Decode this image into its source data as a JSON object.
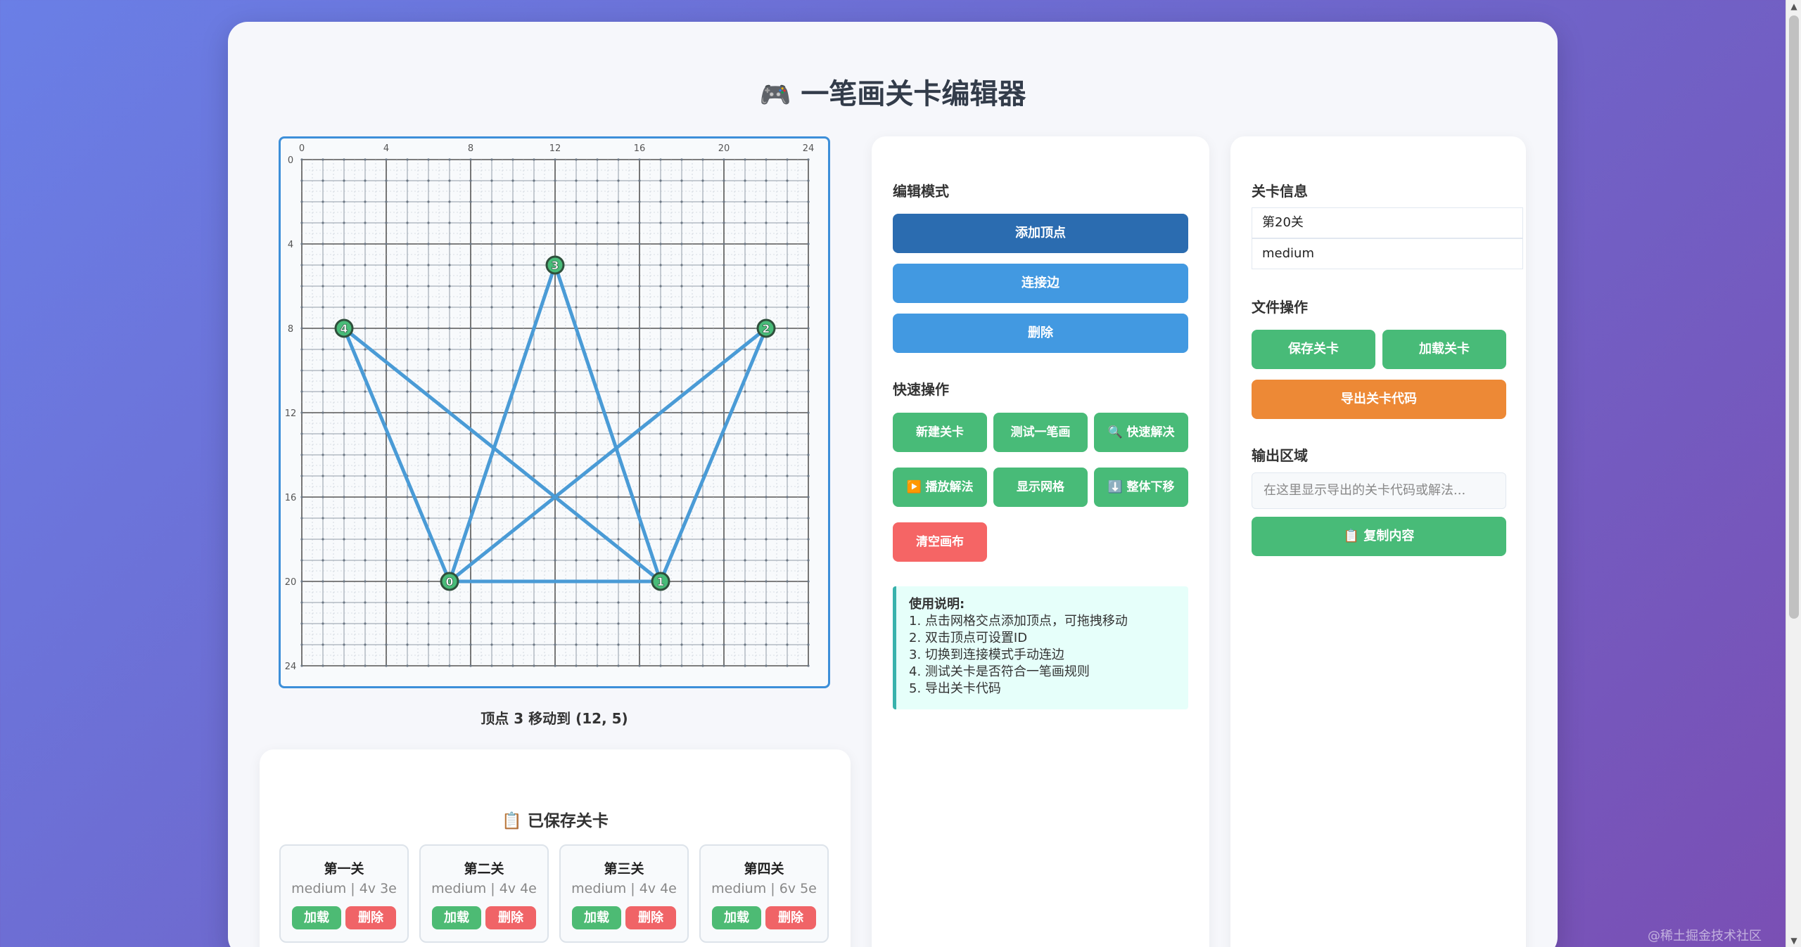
{
  "page": {
    "title_icon": "🎮",
    "title": "一笔画关卡编辑器",
    "status": "顶点 3 移动到 (12, 5)",
    "watermark": "@稀土掘金技术社区"
  },
  "canvas": {
    "grid_size": 24,
    "axis_ticks": [
      0,
      4,
      8,
      12,
      16,
      20,
      24
    ],
    "vertices": [
      {
        "id": "0",
        "x": 7,
        "y": 20
      },
      {
        "id": "1",
        "x": 17,
        "y": 20
      },
      {
        "id": "2",
        "x": 22,
        "y": 8
      },
      {
        "id": "3",
        "x": 12,
        "y": 5
      },
      {
        "id": "4",
        "x": 2,
        "y": 8
      }
    ],
    "edges": [
      [
        "0",
        "1"
      ],
      [
        "0",
        "3"
      ],
      [
        "3",
        "1"
      ],
      [
        "1",
        "4"
      ],
      [
        "4",
        "0"
      ],
      [
        "0",
        "2"
      ],
      [
        "2",
        "1"
      ]
    ],
    "colors": {
      "edge": "#4a9bd6",
      "vertex_fill": "#48bb78",
      "vertex_stroke": "#2f4f3c",
      "grid_major": "#555555",
      "grid_minor": "#b9c2cc"
    }
  },
  "saved": {
    "icon": "📋",
    "title": "已保存关卡",
    "levels": [
      {
        "name": "第一关",
        "meta": "medium | 4v 3e",
        "load": "加载",
        "delete": "删除"
      },
      {
        "name": "第二关",
        "meta": "medium | 4v 4e",
        "load": "加载",
        "delete": "删除"
      },
      {
        "name": "第三关",
        "meta": "medium | 4v 4e",
        "load": "加载",
        "delete": "删除"
      },
      {
        "name": "第四关",
        "meta": "medium | 6v 5e",
        "load": "加载",
        "delete": "删除"
      }
    ]
  },
  "edit": {
    "mode_heading": "编辑模式",
    "modes": [
      "添加顶点",
      "连接边",
      "删除"
    ],
    "quick_heading": "快速操作",
    "quick": {
      "new_level": "新建关卡",
      "test": "测试一笔画",
      "quick_solve": "🔍 快速解决",
      "play_solution": "▶️ 播放解法",
      "show_grid": "显示网格",
      "shift_down": "⬇️ 整体下移",
      "clear": "清空画布"
    },
    "help": {
      "title": "使用说明:",
      "lines": [
        "1. 点击网格交点添加顶点，可拖拽移动",
        "2. 双击顶点可设置ID",
        "3. 切换到连接模式手动连边",
        "4. 测试关卡是否符合一笔画规则",
        "5. 导出关卡代码"
      ]
    }
  },
  "info": {
    "heading": "关卡信息",
    "level_name": "第20关",
    "difficulty": "medium",
    "file_heading": "文件操作",
    "save": "保存关卡",
    "load": "加载关卡",
    "export": "导出关卡代码",
    "output_heading": "输出区域",
    "output_placeholder": "在这里显示导出的关卡代码或解法...",
    "copy": "📋 复制内容"
  }
}
